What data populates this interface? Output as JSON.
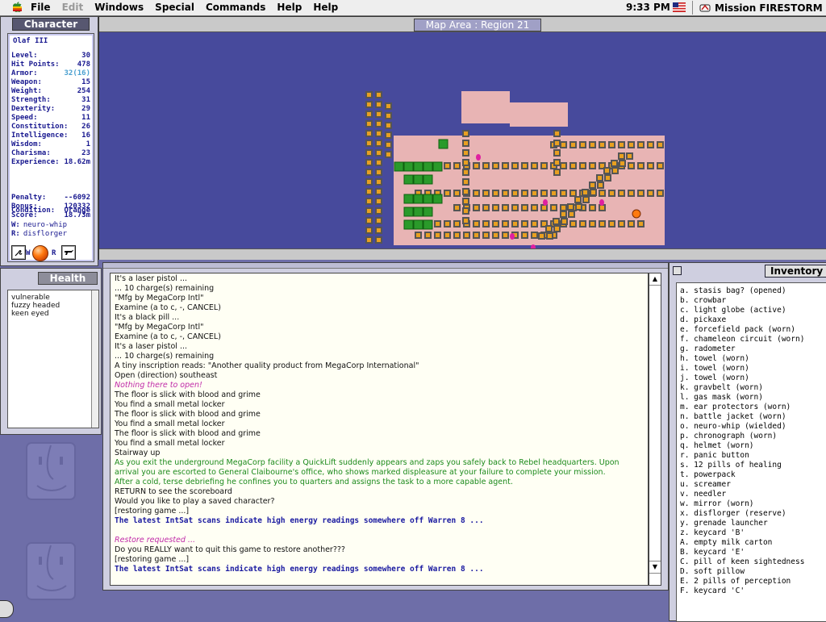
{
  "menubar": {
    "menus": [
      {
        "label": "File",
        "disabled": false
      },
      {
        "label": "Edit",
        "disabled": true
      },
      {
        "label": "Windows",
        "disabled": false
      },
      {
        "label": "Special",
        "disabled": false
      },
      {
        "label": "Commands",
        "disabled": false
      },
      {
        "label": "Help",
        "disabled": false
      },
      {
        "label": "Help",
        "disabled": false
      }
    ],
    "clock": "9:33 PM",
    "app_name": "Mission FIRESTORM"
  },
  "character": {
    "title": "Character",
    "name": "Olaf III",
    "stats": [
      {
        "label": "Level:",
        "value": "30"
      },
      {
        "label": "Hit Points:",
        "value": "478"
      },
      {
        "label": "Armor:",
        "value": "32(16)",
        "highlight": true
      },
      {
        "label": "Weapon:",
        "value": "15"
      },
      {
        "label": "Weight:",
        "value": "254"
      },
      {
        "label": "Strength:",
        "value": "31"
      },
      {
        "label": "Dexterity:",
        "value": "29"
      },
      {
        "label": "Speed:",
        "value": "11"
      },
      {
        "label": "Constitution:",
        "value": "26"
      },
      {
        "label": "Intelligence:",
        "value": "16"
      },
      {
        "label": "Wisdom:",
        "value": "1"
      },
      {
        "label": "Charisma:",
        "value": "23"
      },
      {
        "label": "Experience:",
        "value": "18.62m"
      }
    ],
    "scores": [
      {
        "label": "Penalty:",
        "value": "--6092"
      },
      {
        "label": "Bonus:",
        "value": "120332"
      },
      {
        "label": "Score:",
        "value": "18.73m"
      }
    ],
    "condition": {
      "label": "Condition:",
      "value": "Orange"
    },
    "equipment": [
      {
        "key": "W:",
        "value": "neuro-whip"
      },
      {
        "key": "R:",
        "value": "disflorger"
      }
    ],
    "buttons": {
      "w_label": "W",
      "r_label": "R"
    }
  },
  "health": {
    "title": "Health",
    "items": [
      "vulnerable",
      "fuzzy headed",
      "keen eyed"
    ]
  },
  "map": {
    "title": "Map Area : Region 21"
  },
  "messages": [
    {
      "text": "It's a laser pistol ...",
      "style": "normal"
    },
    {
      "text": "... 10 charge(s) remaining",
      "style": "normal"
    },
    {
      "text": "\"Mfg by MegaCorp Intl\"",
      "style": "normal"
    },
    {
      "text": "Examine (a to c, -, CANCEL)",
      "style": "normal"
    },
    {
      "text": "It's a black pill ...",
      "style": "normal"
    },
    {
      "text": "\"Mfg by MegaCorp Intl\"",
      "style": "normal"
    },
    {
      "text": "Examine (a to c, -, CANCEL)",
      "style": "normal"
    },
    {
      "text": "It's a laser pistol ...",
      "style": "normal"
    },
    {
      "text": "... 10 charge(s) remaining",
      "style": "normal"
    },
    {
      "text": "A tiny inscription reads: \"Another quality product from MegaCorp International\"",
      "style": "normal"
    },
    {
      "text": "Open (direction) southeast",
      "style": "normal"
    },
    {
      "text": "Nothing there to open!",
      "style": "magenta"
    },
    {
      "text": "The floor is slick with blood and grime",
      "style": "normal"
    },
    {
      "text": "You find a small metal locker",
      "style": "normal"
    },
    {
      "text": "The floor is slick with blood and grime",
      "style": "normal"
    },
    {
      "text": "You find a small metal locker",
      "style": "normal"
    },
    {
      "text": "The floor is slick with blood and grime",
      "style": "normal"
    },
    {
      "text": "You find a small metal locker",
      "style": "normal"
    },
    {
      "text": "Stairway up",
      "style": "normal"
    },
    {
      "text": "As you exit the underground MegaCorp facility a QuickLift suddenly appears and zaps you safely back to Rebel headquarters.  Upon",
      "style": "green"
    },
    {
      "text": "arrival you are escorted to General Claibourne's office, who shows marked displeasure at your failure to complete your mission.",
      "style": "green"
    },
    {
      "text": "After a cold, terse debriefing he confines you to quarters and assigns the task to a more capable agent.",
      "style": "green"
    },
    {
      "text": "RETURN to see the scoreboard",
      "style": "normal"
    },
    {
      "text": "Would you like to play a saved character?",
      "style": "normal"
    },
    {
      "text": "[restoring game ...]",
      "style": "normal"
    },
    {
      "text": "The latest IntSat scans indicate high energy readings somewhere off Warren 8 ...",
      "style": "blue"
    },
    {
      "text": "",
      "style": "normal"
    },
    {
      "text": "Restore requested ...",
      "style": "magenta"
    },
    {
      "text": "Do you REALLY want to quit this game to restore another???",
      "style": "normal"
    },
    {
      "text": "[restoring game ...]",
      "style": "normal"
    },
    {
      "text": "The latest IntSat scans indicate high energy readings somewhere off Warren 8 ...",
      "style": "blue"
    }
  ],
  "inventory": {
    "title": "Inventory",
    "items": [
      "a. stasis bag? (opened)",
      "b. crowbar",
      "c. light globe (active)",
      "d. pickaxe",
      "e. forcefield pack (worn)",
      "f. chameleon circuit (worn)",
      "g. radometer",
      "h. towel (worn)",
      "i. towel (worn)",
      "j. towel (worn)",
      "k. gravbelt (worn)",
      "l. gas mask (worn)",
      "m. ear protectors (worn)",
      "n. battle jacket (worn)",
      "o. neuro-whip (wielded)",
      "p. chronograph (worn)",
      "q. helmet (worn)",
      "r. panic button",
      "s. 12 pills of healing",
      "t. powerpack",
      "u. screamer",
      "v. needler",
      "w. mirror (worn)",
      "x. disflorger (reserve)",
      "y. grenade launcher",
      "z. keycard 'B'",
      "A. empty milk carton",
      "B. keycard 'E'",
      "C. pill of keen sightedness",
      "D. soft pillow",
      "E. 2 pills of perception",
      "F. keycard 'C'"
    ]
  },
  "colors": {
    "desktop": "#6e6ea8",
    "map_bg": "#474a9c",
    "floor": "#e8b4b4",
    "wall": "#555555",
    "message_green": "#1c8a1c",
    "message_magenta": "#c02aa8",
    "message_blue": "#1a1aa0"
  }
}
